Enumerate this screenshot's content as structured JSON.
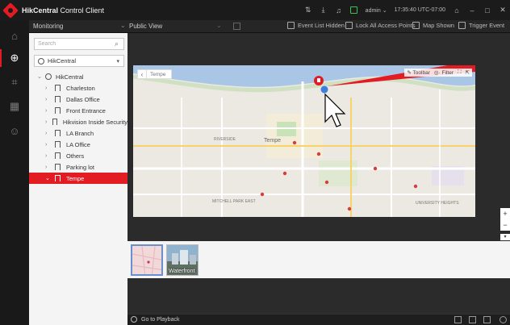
{
  "titlebar": {
    "app_name": "HikCentral",
    "app_suffix": " Control Client",
    "user": "admin",
    "time": "17:35:40 UTC-07:00"
  },
  "modbar": {
    "module": "Monitoring",
    "view": "Public View",
    "event_list": "Event List Hidden",
    "lock_all": "Lock All Access Points",
    "map_shown": "Map Shown",
    "trigger_event": "Trigger Event"
  },
  "panel": {
    "search_placeholder": "Search",
    "site": "HikCentral",
    "tree_root": "HikCentral",
    "areas": [
      {
        "label": "Charleston"
      },
      {
        "label": "Dallas Office"
      },
      {
        "label": "Front Entrance"
      },
      {
        "label": "Hikvision Inside Security"
      },
      {
        "label": "LA Branch"
      },
      {
        "label": "LA Office"
      },
      {
        "label": "Others"
      },
      {
        "label": "Parking lot"
      },
      {
        "label": "Tempe"
      }
    ],
    "selected_area": "Tempe"
  },
  "map": {
    "breadcrumb": "Tempe",
    "toolbar_label": "Toolbar",
    "filter_label": "Filter",
    "zoom_in": "+",
    "zoom_out": "−",
    "place_labels": [
      "RIVERSIDE",
      "MITCHELL PARK EAST",
      "UNIVERSITY HEIGHTS",
      "Tempe"
    ]
  },
  "thumbs": {
    "items": [
      {
        "label": ""
      },
      {
        "label": "Waterfront"
      }
    ]
  },
  "bottombar": {
    "playback": "Go to Playback"
  },
  "colors": {
    "accent": "#e31b23",
    "selection_blue": "#3b7fe0"
  }
}
